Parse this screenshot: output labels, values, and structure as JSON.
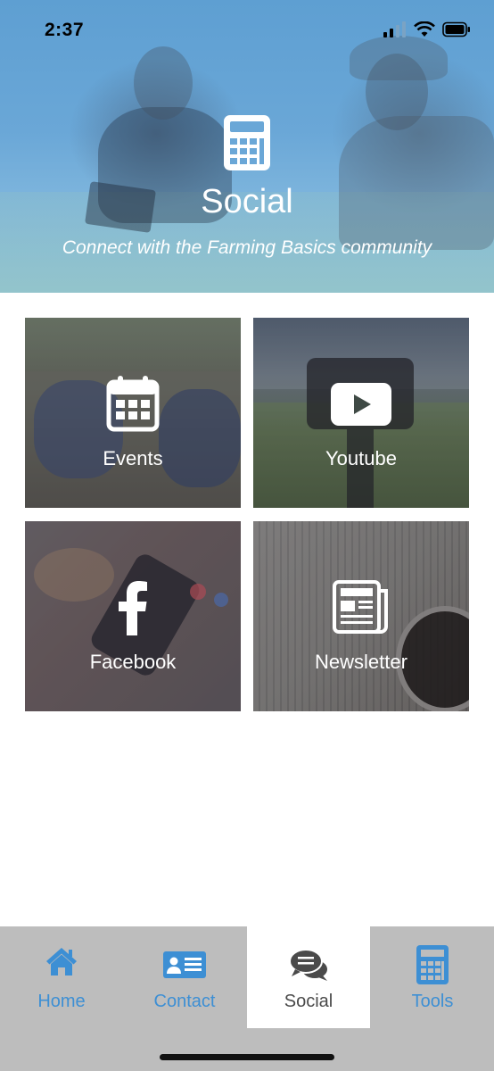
{
  "status_bar": {
    "time": "2:37"
  },
  "hero": {
    "icon": "calculator-icon",
    "title": "Social",
    "subtitle": "Connect with the Farming Basics community"
  },
  "tiles": [
    {
      "label": "Events",
      "icon": "calendar-icon"
    },
    {
      "label": "Youtube",
      "icon": "play-button-icon"
    },
    {
      "label": "Facebook",
      "icon": "facebook-icon"
    },
    {
      "label": "Newsletter",
      "icon": "newspaper-icon"
    }
  ],
  "tabbar": {
    "tabs": [
      {
        "label": "Home",
        "icon": "home-icon",
        "active": false
      },
      {
        "label": "Contact",
        "icon": "contact-card-icon",
        "active": false
      },
      {
        "label": "Social",
        "icon": "chat-bubbles-icon",
        "active": true
      },
      {
        "label": "Tools",
        "icon": "calculator-icon",
        "active": false
      }
    ]
  },
  "colors": {
    "accent": "#3d8fd4",
    "hero_tint": "#6aa7d7",
    "tabbar_bg": "#bdbdbd",
    "active_tab_bg": "#ffffff",
    "active_tab_text": "#4a4a4a"
  }
}
